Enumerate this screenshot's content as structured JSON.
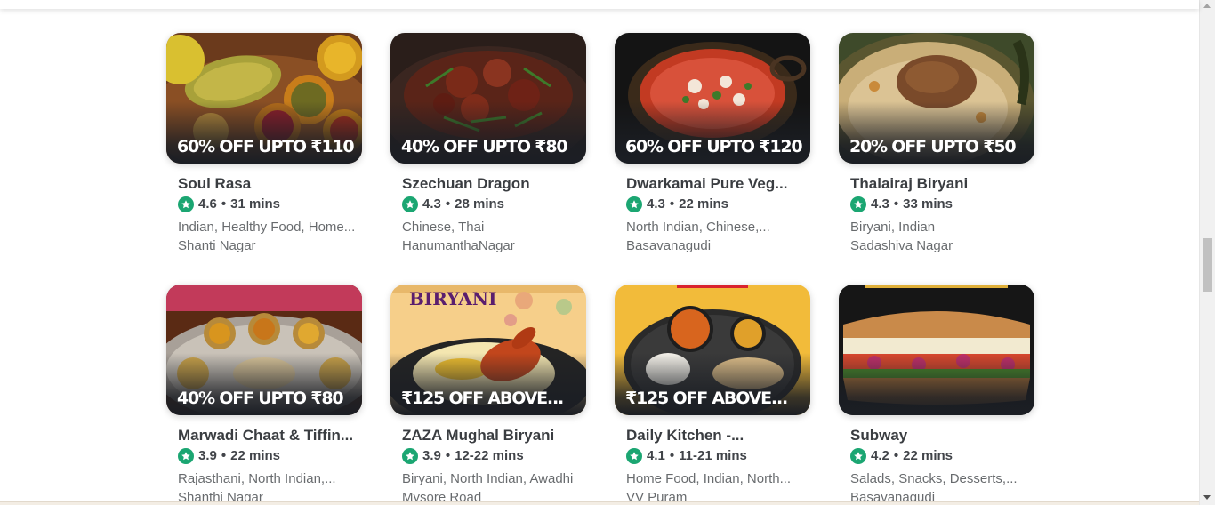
{
  "restaurants": [
    {
      "name": "Soul Rasa",
      "offer": "60% OFF UPTO ₹110",
      "rating": "4.6",
      "time": "31 mins",
      "cuisines": "Indian, Healthy Food, Home...",
      "area": "Shanti Nagar"
    },
    {
      "name": "Szechuan Dragon",
      "offer": "40% OFF UPTO ₹80",
      "rating": "4.3",
      "time": "28 mins",
      "cuisines": "Chinese, Thai",
      "area": "HanumanthaNagar"
    },
    {
      "name": "Dwarkamai Pure Veg...",
      "offer": "60% OFF UPTO ₹120",
      "rating": "4.3",
      "time": "22 mins",
      "cuisines": "North Indian, Chinese,...",
      "area": "Basavanagudi"
    },
    {
      "name": "Thalairaj Biryani",
      "offer": "20% OFF UPTO ₹50",
      "rating": "4.3",
      "time": "33 mins",
      "cuisines": "Biryani, Indian",
      "area": "Sadashiva Nagar"
    },
    {
      "name": "Marwadi Chaat & Tiffin...",
      "offer": "40% OFF UPTO ₹80",
      "rating": "3.9",
      "time": "22 mins",
      "cuisines": "Rajasthani, North Indian,...",
      "area": "Shanthi Nagar"
    },
    {
      "name": "ZAZA Mughal Biryani",
      "offer": "₹125 OFF ABOVE...",
      "rating": "3.9",
      "time": "12-22 mins",
      "cuisines": "Biryani, North Indian, Awadhi",
      "area": "Mysore Road",
      "banner_text": "BIRYANI"
    },
    {
      "name": "Daily Kitchen -...",
      "offer": "₹125 OFF ABOVE...",
      "rating": "4.1",
      "time": "11-21 mins",
      "cuisines": "Home Food, Indian, North...",
      "area": "VV Puram"
    },
    {
      "name": "Subway",
      "offer": "",
      "rating": "4.2",
      "time": "22 mins",
      "cuisines": "Salads, Snacks, Desserts,...",
      "area": "Basavanagudi"
    }
  ],
  "icons": {
    "rating": "star-icon",
    "separator": "•"
  },
  "colors": {
    "rating_badge": "#1ba672",
    "offer_text": "#ffffff",
    "overlay": "#1b1e24"
  }
}
